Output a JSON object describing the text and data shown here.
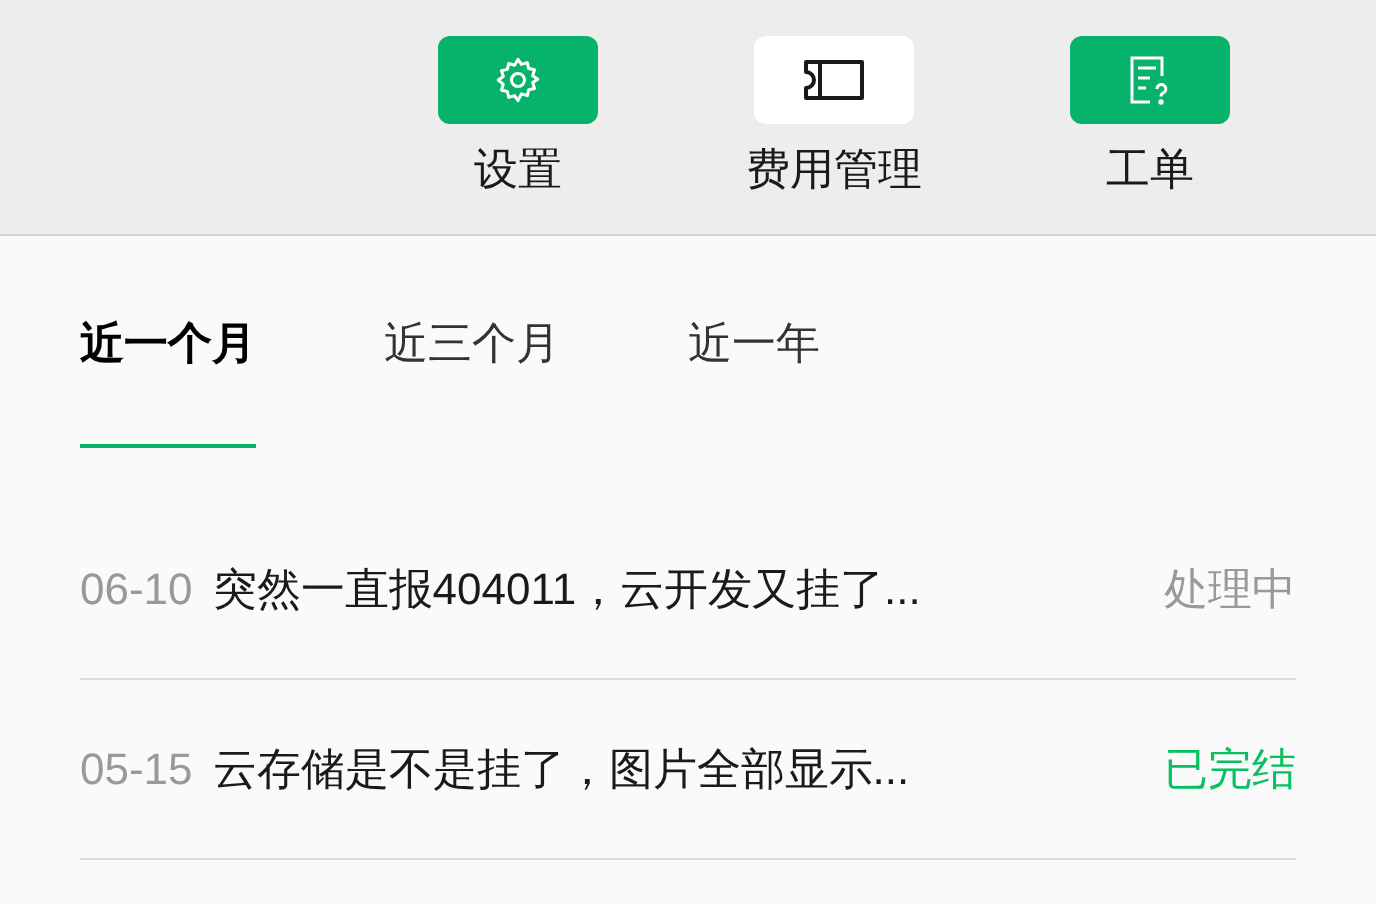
{
  "toolbar": [
    {
      "label": "设置",
      "kind": "gear",
      "active": true
    },
    {
      "label": "费用管理",
      "kind": "ticket",
      "active": false
    },
    {
      "label": "工单",
      "kind": "form",
      "active": true
    }
  ],
  "tabs": [
    {
      "label": "近一个月",
      "selected": true
    },
    {
      "label": "近三个月",
      "selected": false
    },
    {
      "label": "近一年",
      "selected": false
    }
  ],
  "tickets": [
    {
      "date": "06-10",
      "title": "突然一直报404011，云开发又挂了...",
      "status": "处理中",
      "color": "#999999"
    },
    {
      "date": "05-15",
      "title": "云存储是不是挂了，图片全部显示...",
      "status": "已完结",
      "color": "#07c160"
    }
  ]
}
